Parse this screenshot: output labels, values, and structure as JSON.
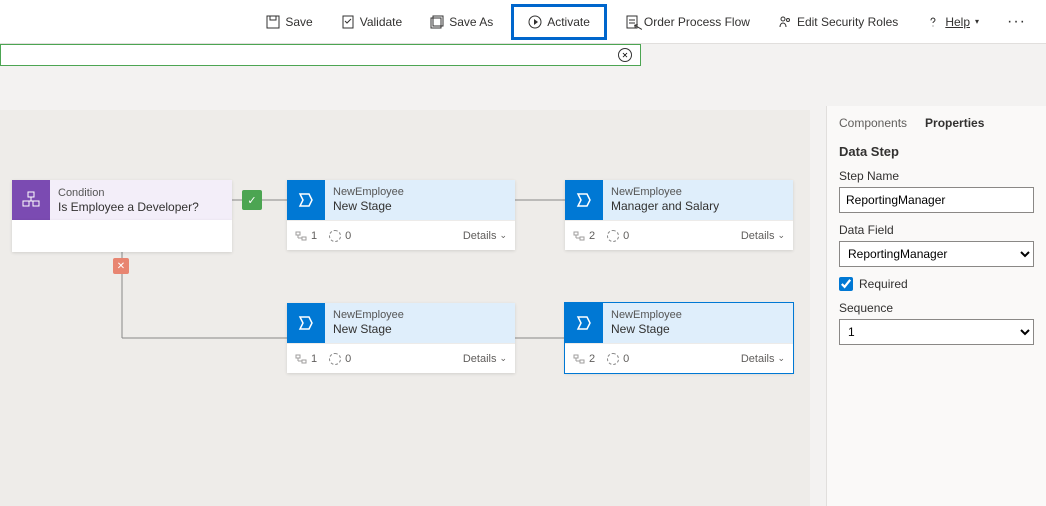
{
  "toolbar": {
    "save": "Save",
    "validate": "Validate",
    "saveas": "Save As",
    "activate": "Activate",
    "orderflow": "Order Process Flow",
    "security": "Edit Security Roles",
    "help": "Help"
  },
  "panel": {
    "tab_components": "Components",
    "tab_properties": "Properties",
    "section_title": "Data Step",
    "stepname_label": "Step Name",
    "stepname_value": "ReportingManager",
    "datafield_label": "Data Field",
    "datafield_value": "ReportingManager",
    "required_label": "Required",
    "sequence_label": "Sequence",
    "sequence_value": "1"
  },
  "condition": {
    "title": "Condition",
    "subtitle": "Is Employee a Developer?"
  },
  "stages": {
    "s1": {
      "entity": "NewEmployee",
      "name": "New Stage",
      "steps": "1",
      "zero": "0",
      "details": "Details"
    },
    "s2": {
      "entity": "NewEmployee",
      "name": "Manager and Salary",
      "steps": "2",
      "zero": "0",
      "details": "Details"
    },
    "s3": {
      "entity": "NewEmployee",
      "name": "New Stage",
      "steps": "1",
      "zero": "0",
      "details": "Details"
    },
    "s4": {
      "entity": "NewEmployee",
      "name": "New Stage",
      "steps": "2",
      "zero": "0",
      "details": "Details"
    }
  }
}
